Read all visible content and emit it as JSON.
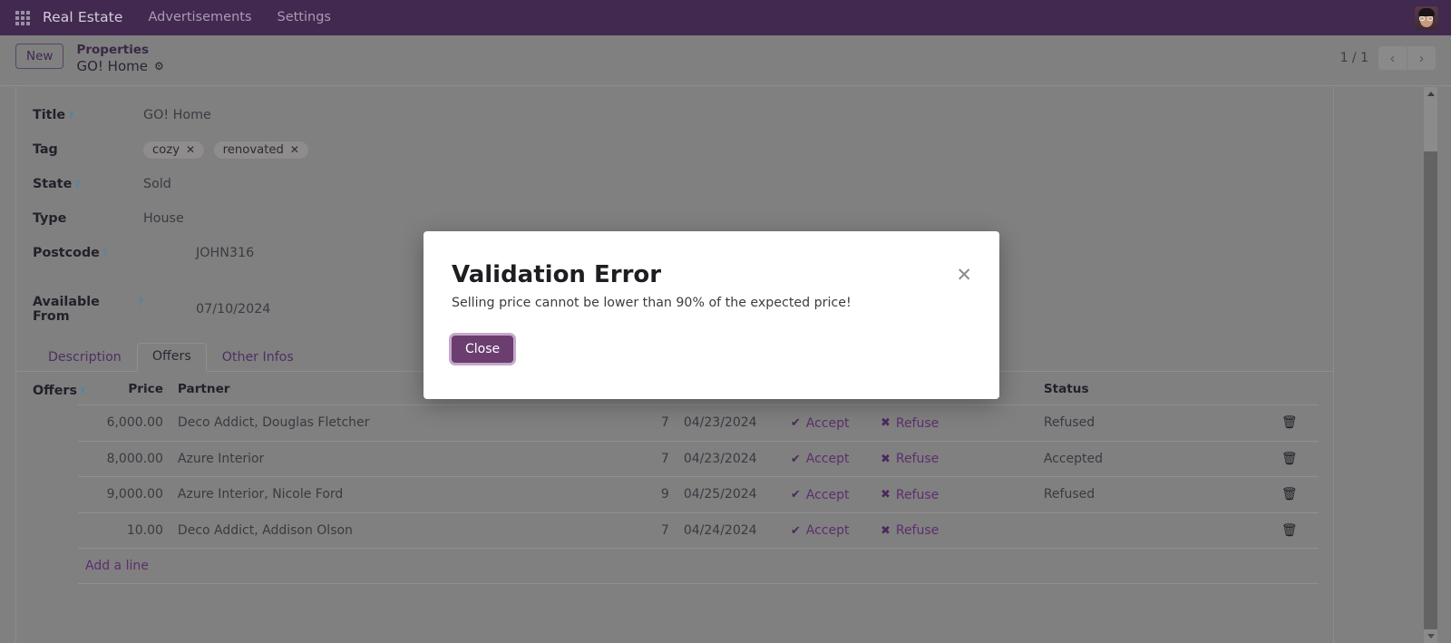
{
  "navbar": {
    "apps_icon": "apps-grid-icon",
    "brand": "Real Estate",
    "menu": [
      "Advertisements",
      "Settings"
    ],
    "avatar_alt": "user-avatar",
    "bg_color": "#41294f"
  },
  "control_panel": {
    "new_label": "New",
    "breadcrumb_parent": "Properties",
    "breadcrumb_current": "GO! Home",
    "gear_icon": "gear-icon",
    "pager_count": "1 / 1",
    "prev_icon": "chevron-left-icon",
    "next_icon": "chevron-right-icon"
  },
  "form": {
    "fields": [
      {
        "label": "Title",
        "help": "?",
        "value": "GO! Home"
      },
      {
        "label": "State",
        "help": "?",
        "value": "Sold"
      },
      {
        "label": "Type",
        "help": "",
        "value": "House"
      },
      {
        "label": "Postcode",
        "help": "?",
        "value": "JOHN316"
      },
      {
        "label": "Available From",
        "help": "?",
        "value": "07/10/2024"
      }
    ],
    "tag": {
      "label": "Tag",
      "chips": [
        "cozy",
        "renovated"
      ],
      "remove_icon": "close-icon"
    }
  },
  "notebook": {
    "tabs": [
      {
        "label": "Description",
        "active": false
      },
      {
        "label": "Offers",
        "active": true
      },
      {
        "label": "Other Infos",
        "active": false
      }
    ]
  },
  "offers": {
    "section_label": "Offers",
    "section_help": "?",
    "columns": [
      "Price",
      "Partner",
      "",
      "",
      "",
      "Status",
      ""
    ],
    "headers": {
      "price": "Price",
      "partner": "Partner",
      "status": "Status"
    },
    "accept_label": "Accept",
    "refuse_label": "Refuse",
    "accept_icon": "check-icon",
    "refuse_icon": "cross-icon",
    "delete_icon": "trash-icon",
    "add_line_label": "Add a line",
    "rows": [
      {
        "price": "6,000.00",
        "partner": "Deco Addict, Douglas Fletcher",
        "validity": "7",
        "deadline": "04/23/2024",
        "status": "Refused"
      },
      {
        "price": "8,000.00",
        "partner": "Azure Interior",
        "validity": "7",
        "deadline": "04/23/2024",
        "status": "Accepted"
      },
      {
        "price": "9,000.00",
        "partner": "Azure Interior, Nicole Ford",
        "validity": "9",
        "deadline": "04/25/2024",
        "status": "Refused"
      },
      {
        "price": "10.00",
        "partner": "Deco Addict, Addison Olson",
        "validity": "7",
        "deadline": "04/24/2024",
        "status": ""
      }
    ]
  },
  "modal": {
    "title": "Validation Error",
    "message": "Selling price cannot be lower than 90% of the expected price!",
    "close_button": "Close",
    "close_icon": "close-icon",
    "button_color": "#6b3e6f"
  },
  "scrollbar": {
    "up_icon": "caret-up-icon",
    "down_icon": "caret-down-icon"
  }
}
